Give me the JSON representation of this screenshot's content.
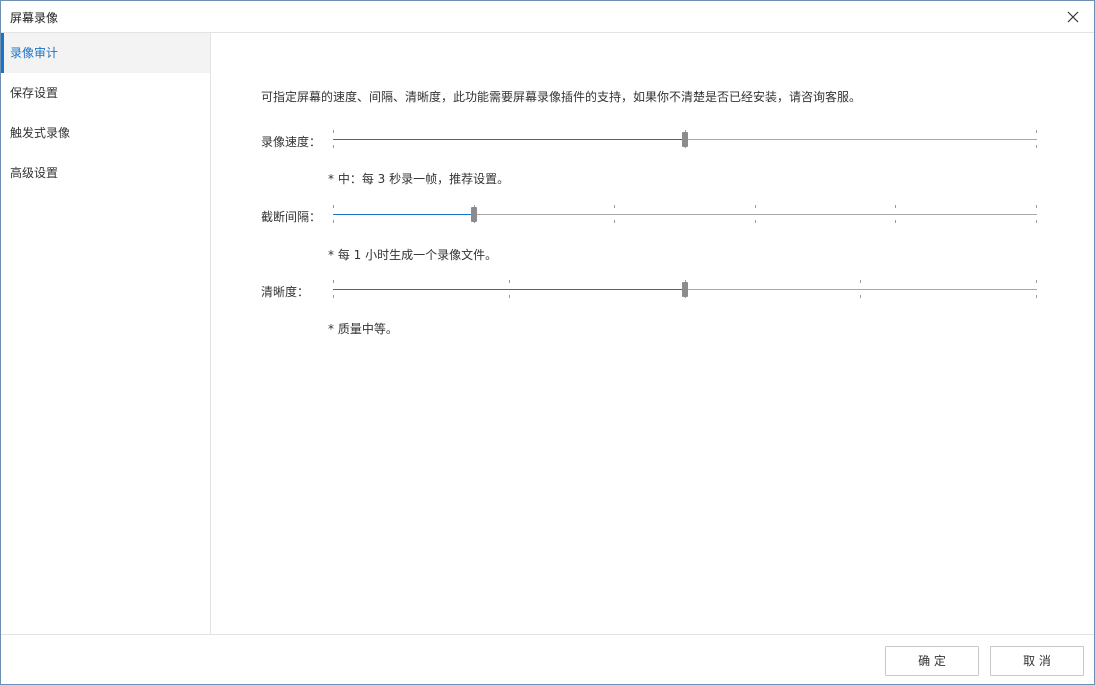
{
  "window": {
    "title": "屏幕录像"
  },
  "sidebar": {
    "items": [
      {
        "label": "录像审计",
        "active": true
      },
      {
        "label": "保存设置",
        "active": false
      },
      {
        "label": "触发式录像",
        "active": false
      },
      {
        "label": "高级设置",
        "active": false
      }
    ]
  },
  "main": {
    "description": "可指定屏幕的速度、间隔、清晰度，此功能需要屏幕录像插件的支持，如果你不清楚是否已经安装，请咨询客服。",
    "settings": [
      {
        "label": "录像速度：",
        "hint": "* 中：每 3 秒录一帧，推荐设置。",
        "steps": 2,
        "value": 1
      },
      {
        "label": "截断间隔：",
        "hint": "* 每 1 小时生成一个录像文件。",
        "steps": 5,
        "value": 1
      },
      {
        "label": "清晰度：",
        "hint": "* 质量中等。",
        "steps": 4,
        "value": 2
      }
    ]
  },
  "footer": {
    "ok_label": "确 定",
    "cancel_label": "取 消"
  },
  "colors": {
    "accent": "#1b73c8",
    "track": "#aaaaaa",
    "thumb": "#8c8c8c",
    "border": "#6d8fb3"
  }
}
